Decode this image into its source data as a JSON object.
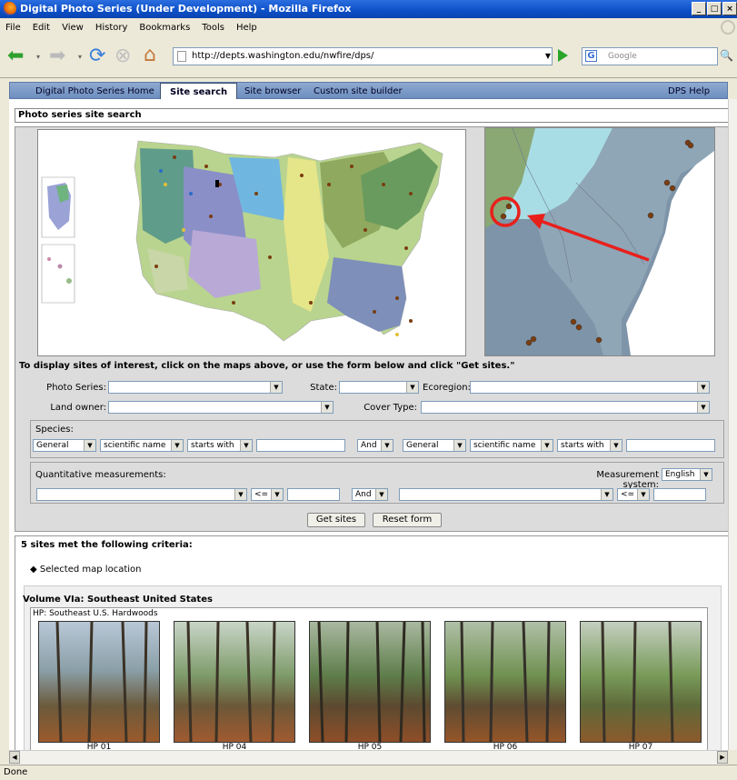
{
  "window": {
    "title": "Digital Photo Series (Under Development) - Mozilla Firefox",
    "controls": [
      "_",
      "□",
      "×"
    ]
  },
  "menu": [
    "File",
    "Edit",
    "View",
    "History",
    "Bookmarks",
    "Tools",
    "Help"
  ],
  "nav": {
    "url": "http://depts.washington.edu/nwfire/dps/",
    "search_placeholder": "Google"
  },
  "tabs": [
    "Digital Photo Series Home",
    "Site search",
    "Site browser",
    "Custom site builder"
  ],
  "help_tab": "DPS Help",
  "panel_title": "Photo series site search",
  "instruction": "To display sites of interest, click on the maps above, or use the form below and click \"Get sites.\"",
  "form": {
    "photo_series_label": "Photo Series:",
    "state_label": "State:",
    "ecoregion_label": "Ecoregion:",
    "land_owner_label": "Land owner:",
    "cover_type_label": "Cover Type:",
    "species_label": "Species:",
    "species_row": [
      "General",
      "scientific name",
      "starts with"
    ],
    "and_label": "And",
    "quant_label": "Quantitative measurements:",
    "measurement_system_label": "Measurement system:",
    "measurement_system_value": "English",
    "operator": "<=",
    "get_sites": "Get sites",
    "reset_form": "Reset form"
  },
  "results": {
    "count_text": "5 sites met the following criteria:",
    "criteria": "Selected map location",
    "volume_title": "Volume VIa:  Southeast United States",
    "photo_caption": "HP: Southeast U.S. Hardwoods",
    "photos": [
      "HP 01",
      "HP 04",
      "HP 05",
      "HP 06",
      "HP 07"
    ]
  },
  "status": "Done",
  "colors": {
    "tabbar": "#7b97c6",
    "annotation": "#e8201b",
    "map_water": "#a9dde6"
  }
}
